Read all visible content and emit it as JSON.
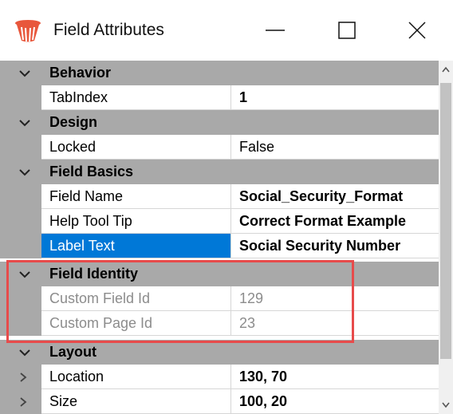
{
  "window": {
    "title": "Field Attributes",
    "icon": "stamp-app-icon",
    "controls": [
      "minimize-icon",
      "maximize-icon",
      "close-icon"
    ]
  },
  "categories": [
    {
      "label": "Behavior",
      "expanded": true,
      "properties": [
        {
          "name": "TabIndex",
          "value": "1",
          "bold": true
        }
      ]
    },
    {
      "label": "Design",
      "expanded": true,
      "properties": [
        {
          "name": "Locked",
          "value": "False",
          "bold": false
        }
      ]
    },
    {
      "label": "Field Basics",
      "expanded": true,
      "properties": [
        {
          "name": "Field Name",
          "value": "Social_Security_Format",
          "bold": true
        },
        {
          "name": "Help Tool Tip",
          "value": "Correct Format Example",
          "bold": true
        },
        {
          "name": "Label Text",
          "value": "Social Security Number",
          "bold": true,
          "selected": true
        }
      ]
    },
    {
      "label": "Field Identity",
      "expanded": true,
      "highlighted": true,
      "properties": [
        {
          "name": "Custom Field Id",
          "value": "129",
          "readonly": true
        },
        {
          "name": "Custom Page Id",
          "value": "23",
          "readonly": true
        }
      ]
    },
    {
      "label": "Layout",
      "expanded": true,
      "properties": [
        {
          "name": "Location",
          "value": "130, 70",
          "bold": true,
          "expandable": true
        },
        {
          "name": "Size",
          "value": "100, 20",
          "bold": true,
          "expandable": true
        }
      ]
    }
  ],
  "colors": {
    "selection": "#0078d7",
    "category_bg": "#a9a9a9",
    "highlight_border": "#e74b4b",
    "readonly_text": "#8c8c8c"
  }
}
